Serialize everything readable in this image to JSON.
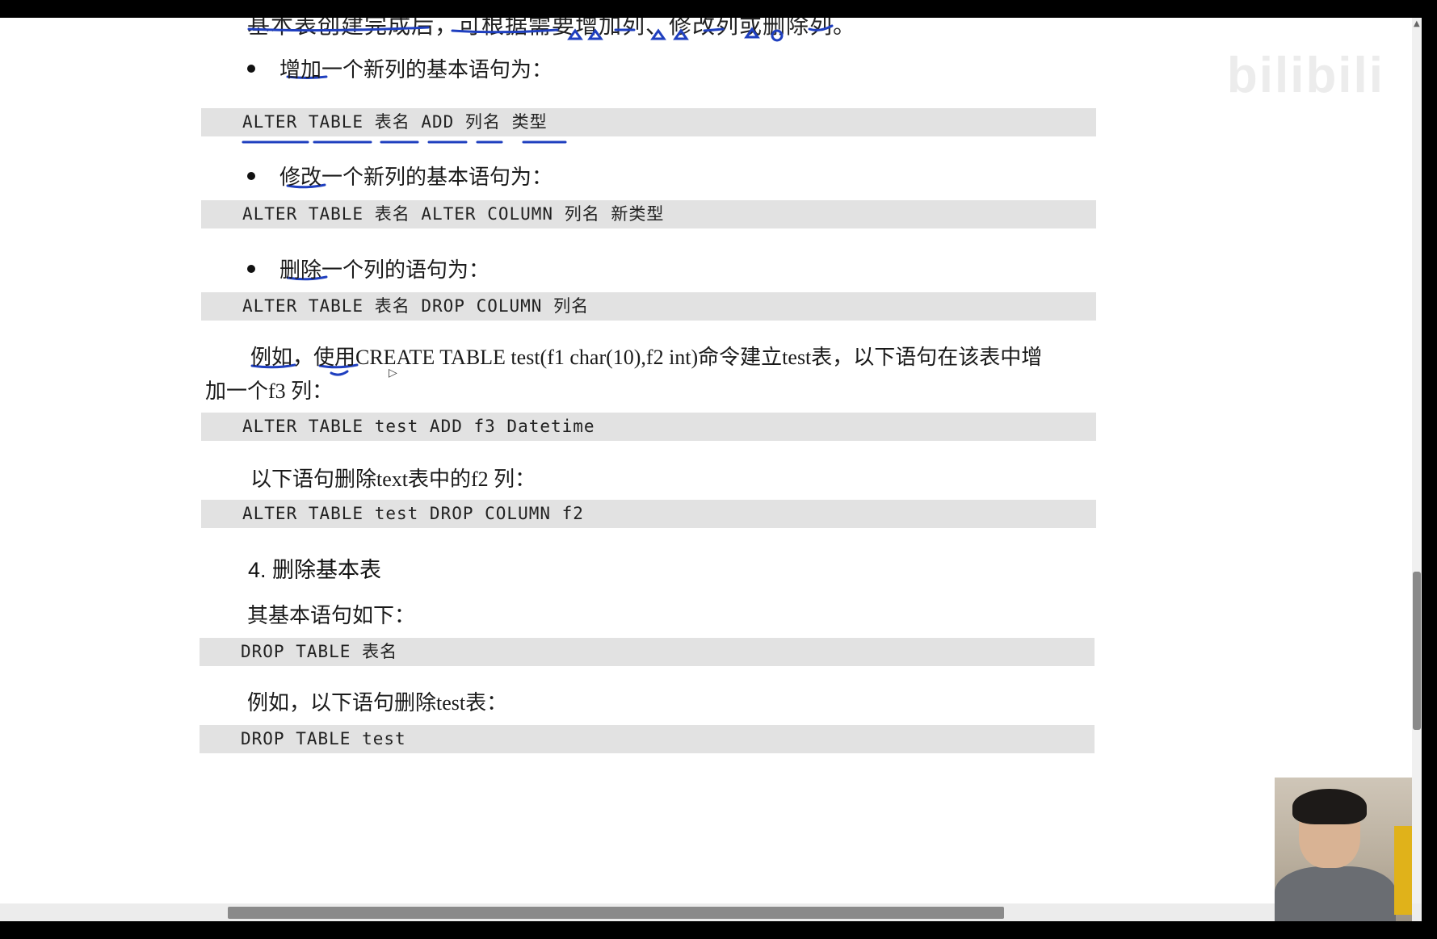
{
  "document": {
    "partial_top_line": "基本表创建完成后，可根据需要增加列、修改列或删除列。",
    "bullets": [
      {
        "text": "增加一个新列的基本语句为："
      },
      {
        "text": "修改一个新列的基本语句为："
      },
      {
        "text": "删除一个列的语句为："
      }
    ],
    "code_blocks": [
      "ALTER TABLE 表名 ADD 列名 类型",
      "ALTER TABLE 表名 ALTER COLUMN 列名 新类型",
      "ALTER TABLE 表名 DROP COLUMN 列名",
      "ALTER TABLE test ADD f3 Datetime",
      "ALTER TABLE test DROP COLUMN f2",
      "DROP TABLE 表名",
      "DROP TABLE test"
    ],
    "example_para_line1": "例如，使用CREATE TABLE test(f1 char(10),f2 int)命令建立test表，以下语句在该表中增",
    "example_para_line2": "加一个f3 列：",
    "delete_col_para": "以下语句删除text表中的f2 列：",
    "section_heading": "4. 删除基本表",
    "basic_stmt_para": "其基本语句如下：",
    "drop_example_para": "例如，以下语句删除test表："
  },
  "watermark": "bilibili",
  "icons": {
    "cursor": "cursor-arrow-icon",
    "scroll_up": "scroll-up-arrow-icon"
  },
  "colors": {
    "annotation_ink": "#1f3fbf",
    "code_background": "#e2e2e2"
  }
}
